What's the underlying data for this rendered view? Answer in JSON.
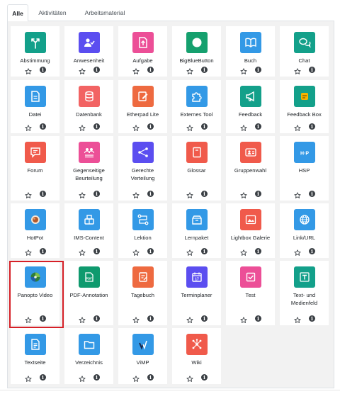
{
  "tabs": [
    {
      "label": "Alle"
    },
    {
      "label": "Aktivitäten"
    },
    {
      "label": "Arbeitsmaterial"
    }
  ],
  "modules": [
    {
      "name": "Abstimmung",
      "icon": "split-arrows-icon",
      "color": "#13a08a"
    },
    {
      "name": "Anwesenheit",
      "icon": "attendance-icon",
      "color": "#5b4ef0"
    },
    {
      "name": "Aufgabe",
      "icon": "upload-file-icon",
      "color": "#ec4f97"
    },
    {
      "name": "BigBlueButton",
      "icon": "bigbluebutton-icon",
      "color": "#15a06e"
    },
    {
      "name": "Buch",
      "icon": "book-icon",
      "color": "#3399e6"
    },
    {
      "name": "Chat",
      "icon": "chat-bubbles-icon",
      "color": "#13a08a"
    },
    {
      "name": "Datei",
      "icon": "file-icon",
      "color": "#3399e6"
    },
    {
      "name": "Datenbank",
      "icon": "database-icon",
      "color": "#f26363"
    },
    {
      "name": "Etherpad Lite",
      "icon": "etherpad-icon",
      "color": "#ee6a40"
    },
    {
      "name": "Externes Tool",
      "icon": "puzzle-icon",
      "color": "#3399e6"
    },
    {
      "name": "Feedback",
      "icon": "megaphone-icon",
      "color": "#13a08a"
    },
    {
      "name": "Feedback Box",
      "icon": "feedback-box-icon",
      "color": "#13a08a"
    },
    {
      "name": "Forum",
      "icon": "forum-icon",
      "color": "#f05a4b"
    },
    {
      "name": "Gegenseitige\nBeurteilung",
      "icon": "peer-review-icon",
      "color": "#ec4f97"
    },
    {
      "name": "Gerechte\nVerteilung",
      "icon": "share-nodes-icon",
      "color": "#5b4ef0"
    },
    {
      "name": "Glossar",
      "icon": "glossary-icon",
      "color": "#f05a4b"
    },
    {
      "name": "Gruppenwahl",
      "icon": "group-choice-icon",
      "color": "#f05a4b"
    },
    {
      "name": "HSP",
      "icon": "h5p-icon",
      "color": "#3399e6"
    },
    {
      "name": "HotPot",
      "icon": "hotpot-icon",
      "color": "#3399e6"
    },
    {
      "name": "IMS-Content",
      "icon": "package-icon",
      "color": "#3399e6"
    },
    {
      "name": "Lektion",
      "icon": "lesson-path-icon",
      "color": "#3399e6"
    },
    {
      "name": "Lernpaket",
      "icon": "scorm-package-icon",
      "color": "#3399e6"
    },
    {
      "name": "Lightbox Galerie",
      "icon": "gallery-icon",
      "color": "#f05a4b"
    },
    {
      "name": "Link/URL",
      "icon": "globe-icon",
      "color": "#3399e6"
    },
    {
      "name": "Panopto Video",
      "icon": "panopto-icon",
      "color": "#3399e6"
    },
    {
      "name": "PDF-Annotation",
      "icon": "pdf-annotation-icon",
      "color": "#0f9a6e"
    },
    {
      "name": "Tagebuch",
      "icon": "journal-icon",
      "color": "#ee6a40"
    },
    {
      "name": "Terminplaner",
      "icon": "calendar-icon",
      "color": "#5b4ef0"
    },
    {
      "name": "Test",
      "icon": "checkbox-icon",
      "color": "#ec4f97"
    },
    {
      "name": "Text- und\nMedienfeld",
      "icon": "text-media-icon",
      "color": "#13a08a"
    },
    {
      "name": "Textseite",
      "icon": "text-page-icon",
      "color": "#3399e6"
    },
    {
      "name": "Verzeichnis",
      "icon": "folder-icon",
      "color": "#3399e6"
    },
    {
      "name": "ViMP",
      "icon": "vimp-icon",
      "color": "#3399e6"
    },
    {
      "name": "Wiki",
      "icon": "wiki-network-icon",
      "color": "#f05a4b"
    }
  ],
  "info_glyph": "i"
}
